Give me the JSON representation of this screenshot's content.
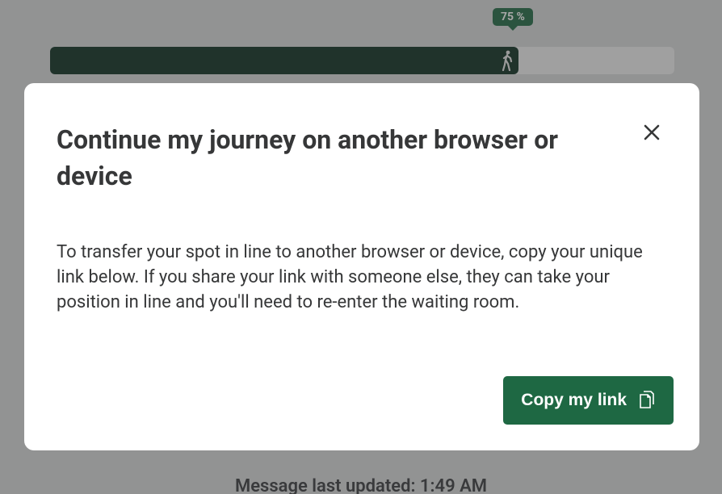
{
  "progress": {
    "percent_label": "75 %",
    "percent_value": 75
  },
  "footer": {
    "message": "Message last updated: 1:49 AM"
  },
  "modal": {
    "title": "Continue my journey on another browser or device",
    "body": "To transfer your spot in line to another browser or device, copy your unique link below. If you share your link with someone else, they can take your position in line and you'll need to re-enter the waiting room.",
    "copy_button": "Copy my link"
  },
  "colors": {
    "accent": "#1e6843",
    "dark_fill": "#0a2d1e"
  }
}
